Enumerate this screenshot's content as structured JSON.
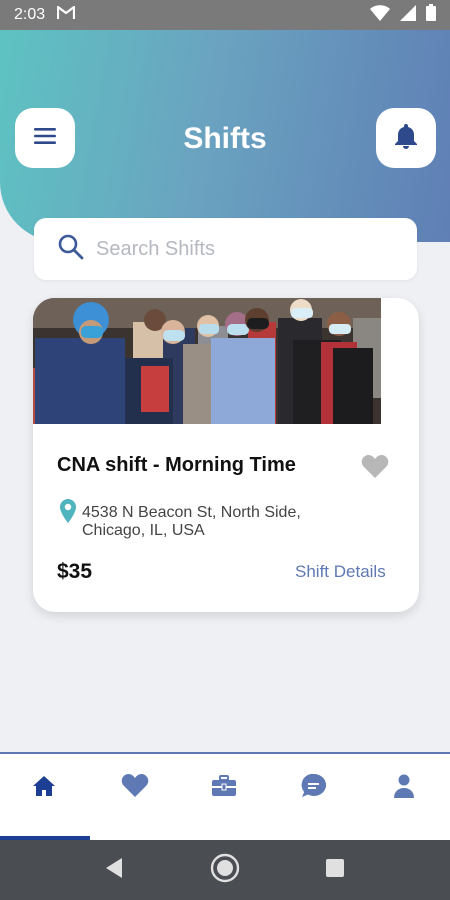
{
  "status_bar": {
    "time": "2:03"
  },
  "header": {
    "title": "Shifts"
  },
  "search": {
    "placeholder": "Search Shifts",
    "value": ""
  },
  "shift_card": {
    "title": "CNA shift - Morning Time",
    "address": "4538 N Beacon St, North Side, Chicago, IL, USA",
    "price": "$35",
    "details_link": "Shift Details",
    "favorited": false
  },
  "bottom_nav": {
    "items": [
      "home-icon",
      "heart-icon",
      "briefcase-icon",
      "chat-icon",
      "person-icon"
    ],
    "active_index": 0
  },
  "colors": {
    "accent": "#1c3f93",
    "nav_icon": "#5e79b3",
    "teal": "#4fb4bd",
    "header_gradient_start": "#5ec3c2",
    "header_gradient_end": "#5f7fb5"
  }
}
